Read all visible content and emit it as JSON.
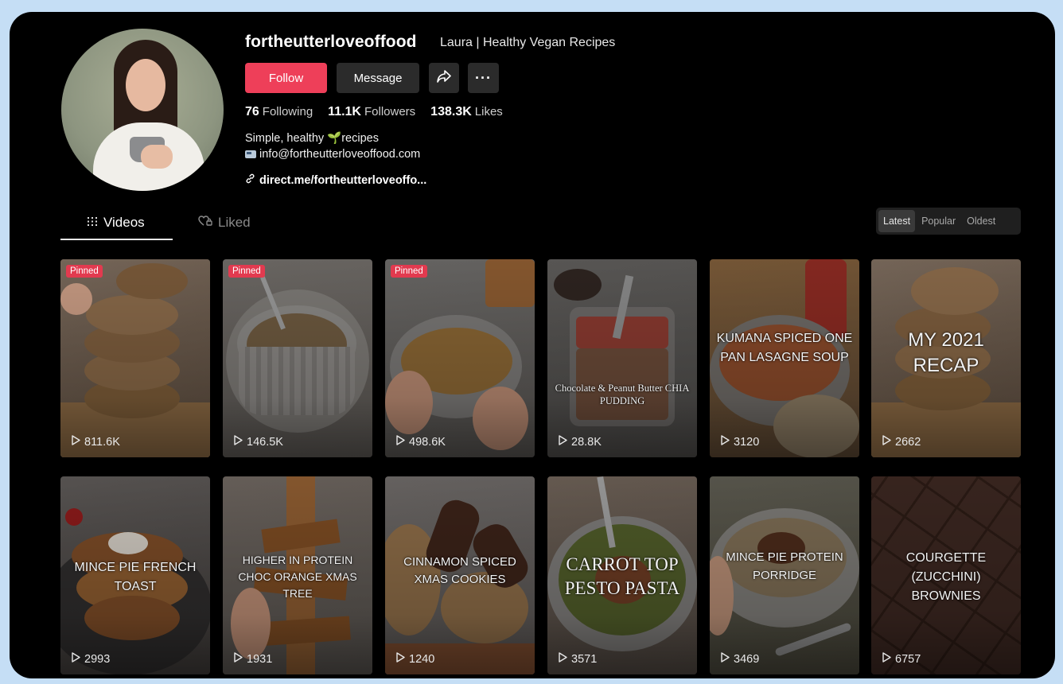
{
  "profile": {
    "username": "fortheutterloveoffood",
    "display_name": "Laura | Healthy Vegan Recipes",
    "follow_label": "Follow",
    "message_label": "Message",
    "more_label": "···",
    "stats": [
      {
        "value": "76",
        "label": "Following"
      },
      {
        "value": "11.1K",
        "label": "Followers"
      },
      {
        "value": "138.3K",
        "label": "Likes"
      }
    ],
    "bio_line1": "Simple, healthy 🌱recipes",
    "bio_line2": "info@fortheutterloveoffood.com",
    "link": "direct.me/fortheutterloveoffo..."
  },
  "tabs": [
    {
      "label": "Videos",
      "active": true,
      "icon": "grid-icon"
    },
    {
      "label": "Liked",
      "active": false,
      "icon": "heart-lock-icon"
    }
  ],
  "sort_options": [
    "Latest",
    "Popular",
    "Oldest"
  ],
  "sort_selected": "Latest",
  "pinned_label": "Pinned",
  "videos": [
    {
      "views": "811.6K",
      "pinned": true,
      "overlay": ""
    },
    {
      "views": "146.5K",
      "pinned": true,
      "overlay": ""
    },
    {
      "views": "498.6K",
      "pinned": true,
      "overlay": ""
    },
    {
      "views": "28.8K",
      "pinned": false,
      "overlay": "Chocolate & Peanut Butter CHIA PUDDING"
    },
    {
      "views": "3120",
      "pinned": false,
      "overlay": "KUMANA SPICED ONE PAN LASAGNE SOUP"
    },
    {
      "views": "2662",
      "pinned": false,
      "overlay": "MY 2021 RECAP"
    },
    {
      "views": "2993",
      "pinned": false,
      "overlay": "MINCE PIE FRENCH TOAST"
    },
    {
      "views": "1931",
      "pinned": false,
      "overlay": "HIGHER IN PROTEIN CHOC ORANGE XMAS TREE"
    },
    {
      "views": "1240",
      "pinned": false,
      "overlay": "CINNAMON SPICED XMAS COOKIES"
    },
    {
      "views": "3571",
      "pinned": false,
      "overlay": "CARROT TOP PESTO PASTA"
    },
    {
      "views": "3469",
      "pinned": false,
      "overlay": "MINCE PIE PROTEIN PORRIDGE"
    },
    {
      "views": "6757",
      "pinned": false,
      "overlay": "COURGETTE (ZUCCHINI) BROWNIES"
    }
  ],
  "colors": {
    "follow": "#ee3f59",
    "background": "#000000",
    "page": "#c5def5",
    "pinned": "#e23a4f"
  }
}
